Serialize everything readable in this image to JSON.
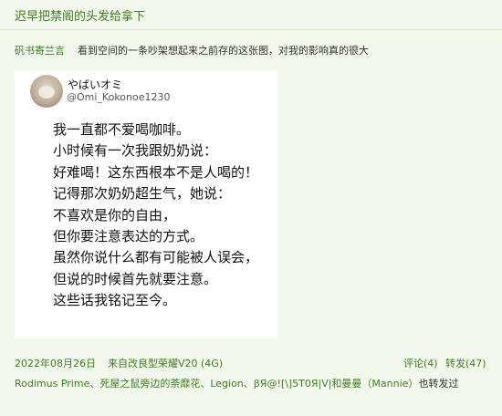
{
  "header": {
    "title": "迟早把禁阁的头发给拿下"
  },
  "post": {
    "author": "矾书寄兰言",
    "text": "看到空间的一条吵架想起来之前存的这张图，对我的影响真的很大"
  },
  "embedded_tweet": {
    "display_name": "やばいオミ",
    "handle": "@Omi_Kokonoe1230",
    "lines": [
      "我一直都不爱喝咖啡。",
      "小时候有一次我跟奶奶说：",
      "好难喝！这东西根本不是人喝的！",
      "记得那次奶奶超生气，她说：",
      "不喜欢是你的自由，",
      "但你要注意表达的方式。",
      "虽然你说什么都有可能被人误会，",
      "但说的时候首先就要注意。",
      "这些话我铭记至今。"
    ]
  },
  "meta": {
    "date": "2022年08月26日",
    "source": "来自改良型荣耀V20 (4G)",
    "comments": "评论(4)",
    "reposts": "转发(47)"
  },
  "reposters": {
    "names": "Rodimus Prime、死屋之鼠旁边的荼靡花、Legion、βЯ@![\\]5T0Я|V|和曼曼（Mannie）",
    "suffix": "也转发过"
  }
}
